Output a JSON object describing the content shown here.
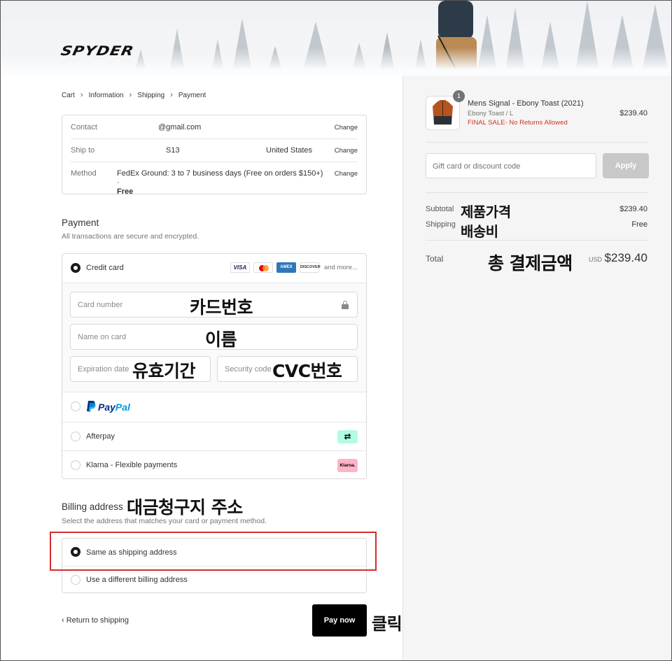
{
  "brand": {
    "logo_text": "SPYDER"
  },
  "breadcrumb": {
    "items": [
      "Cart",
      "Information",
      "Shipping",
      "Payment"
    ]
  },
  "info": {
    "contact_label": "Contact",
    "contact_value": "@gmail.com",
    "shipto_label": "Ship to",
    "shipto_value": "S13",
    "shipto_country": "United States",
    "method_label": "Method",
    "method_value": "FedEx Ground: 3 to 7 business days (Free on orders $150+) ·",
    "method_price": "Free",
    "change_label": "Change"
  },
  "payment": {
    "title": "Payment",
    "subtitle": "All transactions are secure and encrypted.",
    "credit_card_label": "Credit card",
    "card_logos": [
      "VISA",
      "mastercard",
      "AMEX",
      "DISCOVER"
    ],
    "more_label": "and more...",
    "card_number_placeholder": "Card number",
    "name_on_card_placeholder": "Name on card",
    "expiration_placeholder": "Expiration date",
    "security_code_placeholder": "Security code",
    "paypal_label_a": "Pay",
    "paypal_label_b": "Pal",
    "afterpay_label": "Afterpay",
    "afterpay_icon": "⇄",
    "klarna_label": "Klarna - Flexible payments",
    "klarna_badge": "Klarna."
  },
  "billing": {
    "title": "Billing address",
    "subtitle": "Select the address that matches your card or payment method.",
    "same_label": "Same as shipping address",
    "different_label": "Use a different billing address"
  },
  "actions": {
    "return_label": "Return to shipping",
    "pay_label": "Pay now"
  },
  "summary": {
    "qty": "1",
    "product_name": "Mens Signal - Ebony Toast (2021)",
    "product_variant": "Ebony Toast / L",
    "product_note": "FINAL SALE- No Returns Allowed",
    "product_price": "$239.40",
    "discount_placeholder": "Gift card or discount code",
    "apply_label": "Apply",
    "subtotal_label": "Subtotal",
    "subtotal_value": "$239.40",
    "shipping_label": "Shipping",
    "shipping_value": "Free",
    "total_label": "Total",
    "total_currency": "USD",
    "total_value": "$239.40"
  },
  "annotations": {
    "card_number": "카드번호",
    "name": "이름",
    "expiry": "유효기간",
    "cvc": "CVC번호",
    "billing": "대금청구지 주소",
    "product_price": "제품가격",
    "shipping_fee": "배송비",
    "total": "총 결제금액",
    "click": "클릭"
  },
  "colors": {
    "accent_red": "#d62d2d",
    "sale_red": "#c23b22",
    "pay_button": "#000000",
    "afterpay_mint": "#b2fce4",
    "klarna_pink": "#ffb3c7"
  }
}
